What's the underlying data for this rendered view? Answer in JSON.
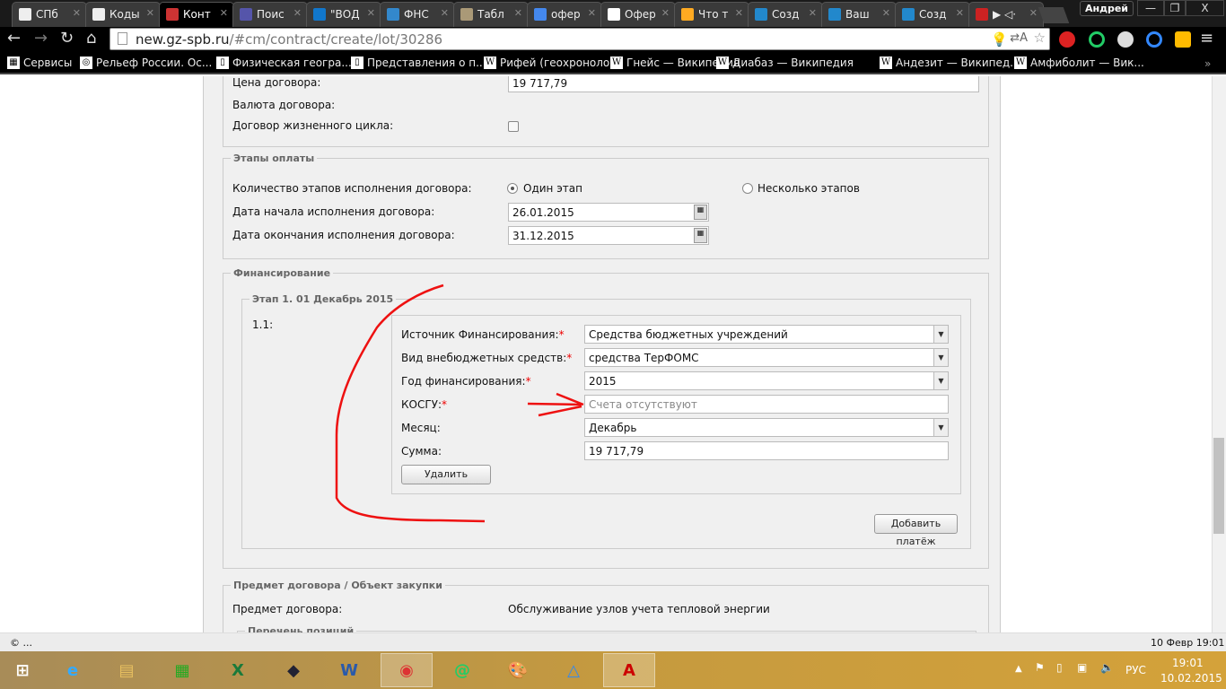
{
  "browser": {
    "tabs": [
      {
        "label": "СПб"
      },
      {
        "label": "Коды"
      },
      {
        "label": "Конт",
        "active": true
      },
      {
        "label": "Поис"
      },
      {
        "label": "\"ВОД"
      },
      {
        "label": "ФНС"
      },
      {
        "label": "Табл"
      },
      {
        "label": "офер"
      },
      {
        "label": "Офер"
      },
      {
        "label": "Что т"
      },
      {
        "label": "Созд"
      },
      {
        "label": "Ваш"
      },
      {
        "label": "Созд"
      },
      {
        "label": "▶ ◁·"
      }
    ],
    "user": "Андрей",
    "url_host": "new.gz-spb.ru",
    "url_path": "/#cm/contract/create/lot/30286",
    "bookmarks": [
      {
        "label": "Сервисы"
      },
      {
        "label": "Рельеф России. Ос..."
      },
      {
        "label": "Физическая геогра..."
      },
      {
        "label": "Представления о п..."
      },
      {
        "label": "Рифей (геохроноло..."
      },
      {
        "label": "Гнейс — Википедия"
      },
      {
        "label": "Диабаз — Википедия"
      },
      {
        "label": "Андезит — Википед..."
      },
      {
        "label": "Амфиболит — Вик..."
      }
    ],
    "status": "© ...",
    "status_right": "10 Февр 19:01"
  },
  "contract": {
    "price_label": "Цена договора:",
    "price": "19 717,79",
    "currency_label": "Валюта договора:",
    "lifecycle_label": "Договор жизненного цикла:"
  },
  "payments": {
    "legend": "Этапы оплаты",
    "stages_label": "Количество этапов исполнения договора:",
    "one": "Один этап",
    "many": "Несколько этапов",
    "start_label": "Дата начала исполнения договора:",
    "start": "26.01.2015",
    "end_label": "Дата окончания исполнения договора:",
    "end": "31.12.2015"
  },
  "financing": {
    "legend": "Финансирование",
    "stage_legend": "Этап 1. 01 Декабрь 2015",
    "item_num": "1.1:",
    "source_label": "Источник Финансирования:",
    "source": "Средства бюджетных учреждений",
    "kind_label": "Вид внебюджетных средств:",
    "kind": "средства ТерФОМС",
    "year_label": "Год финансирования:",
    "year": "2015",
    "kosgu_label": "КОСГУ:",
    "kosgu_placeholder": "Счета отсутствуют",
    "month_label": "Месяц:",
    "month": "Декабрь",
    "sum_label": "Сумма:",
    "sum": "19 717,79",
    "required": "*",
    "delete": "Удалить",
    "add_payment": "Добавить платёж"
  },
  "subject": {
    "legend": "Предмет договора / Объект закупки",
    "label": "Предмет договора:",
    "value": "Обслуживание узлов учета тепловой энергии",
    "positions_legend": "Перечень позиций"
  },
  "taskbar": {
    "lang": "РУС",
    "time": "19:01",
    "date": "10.02.2015"
  }
}
